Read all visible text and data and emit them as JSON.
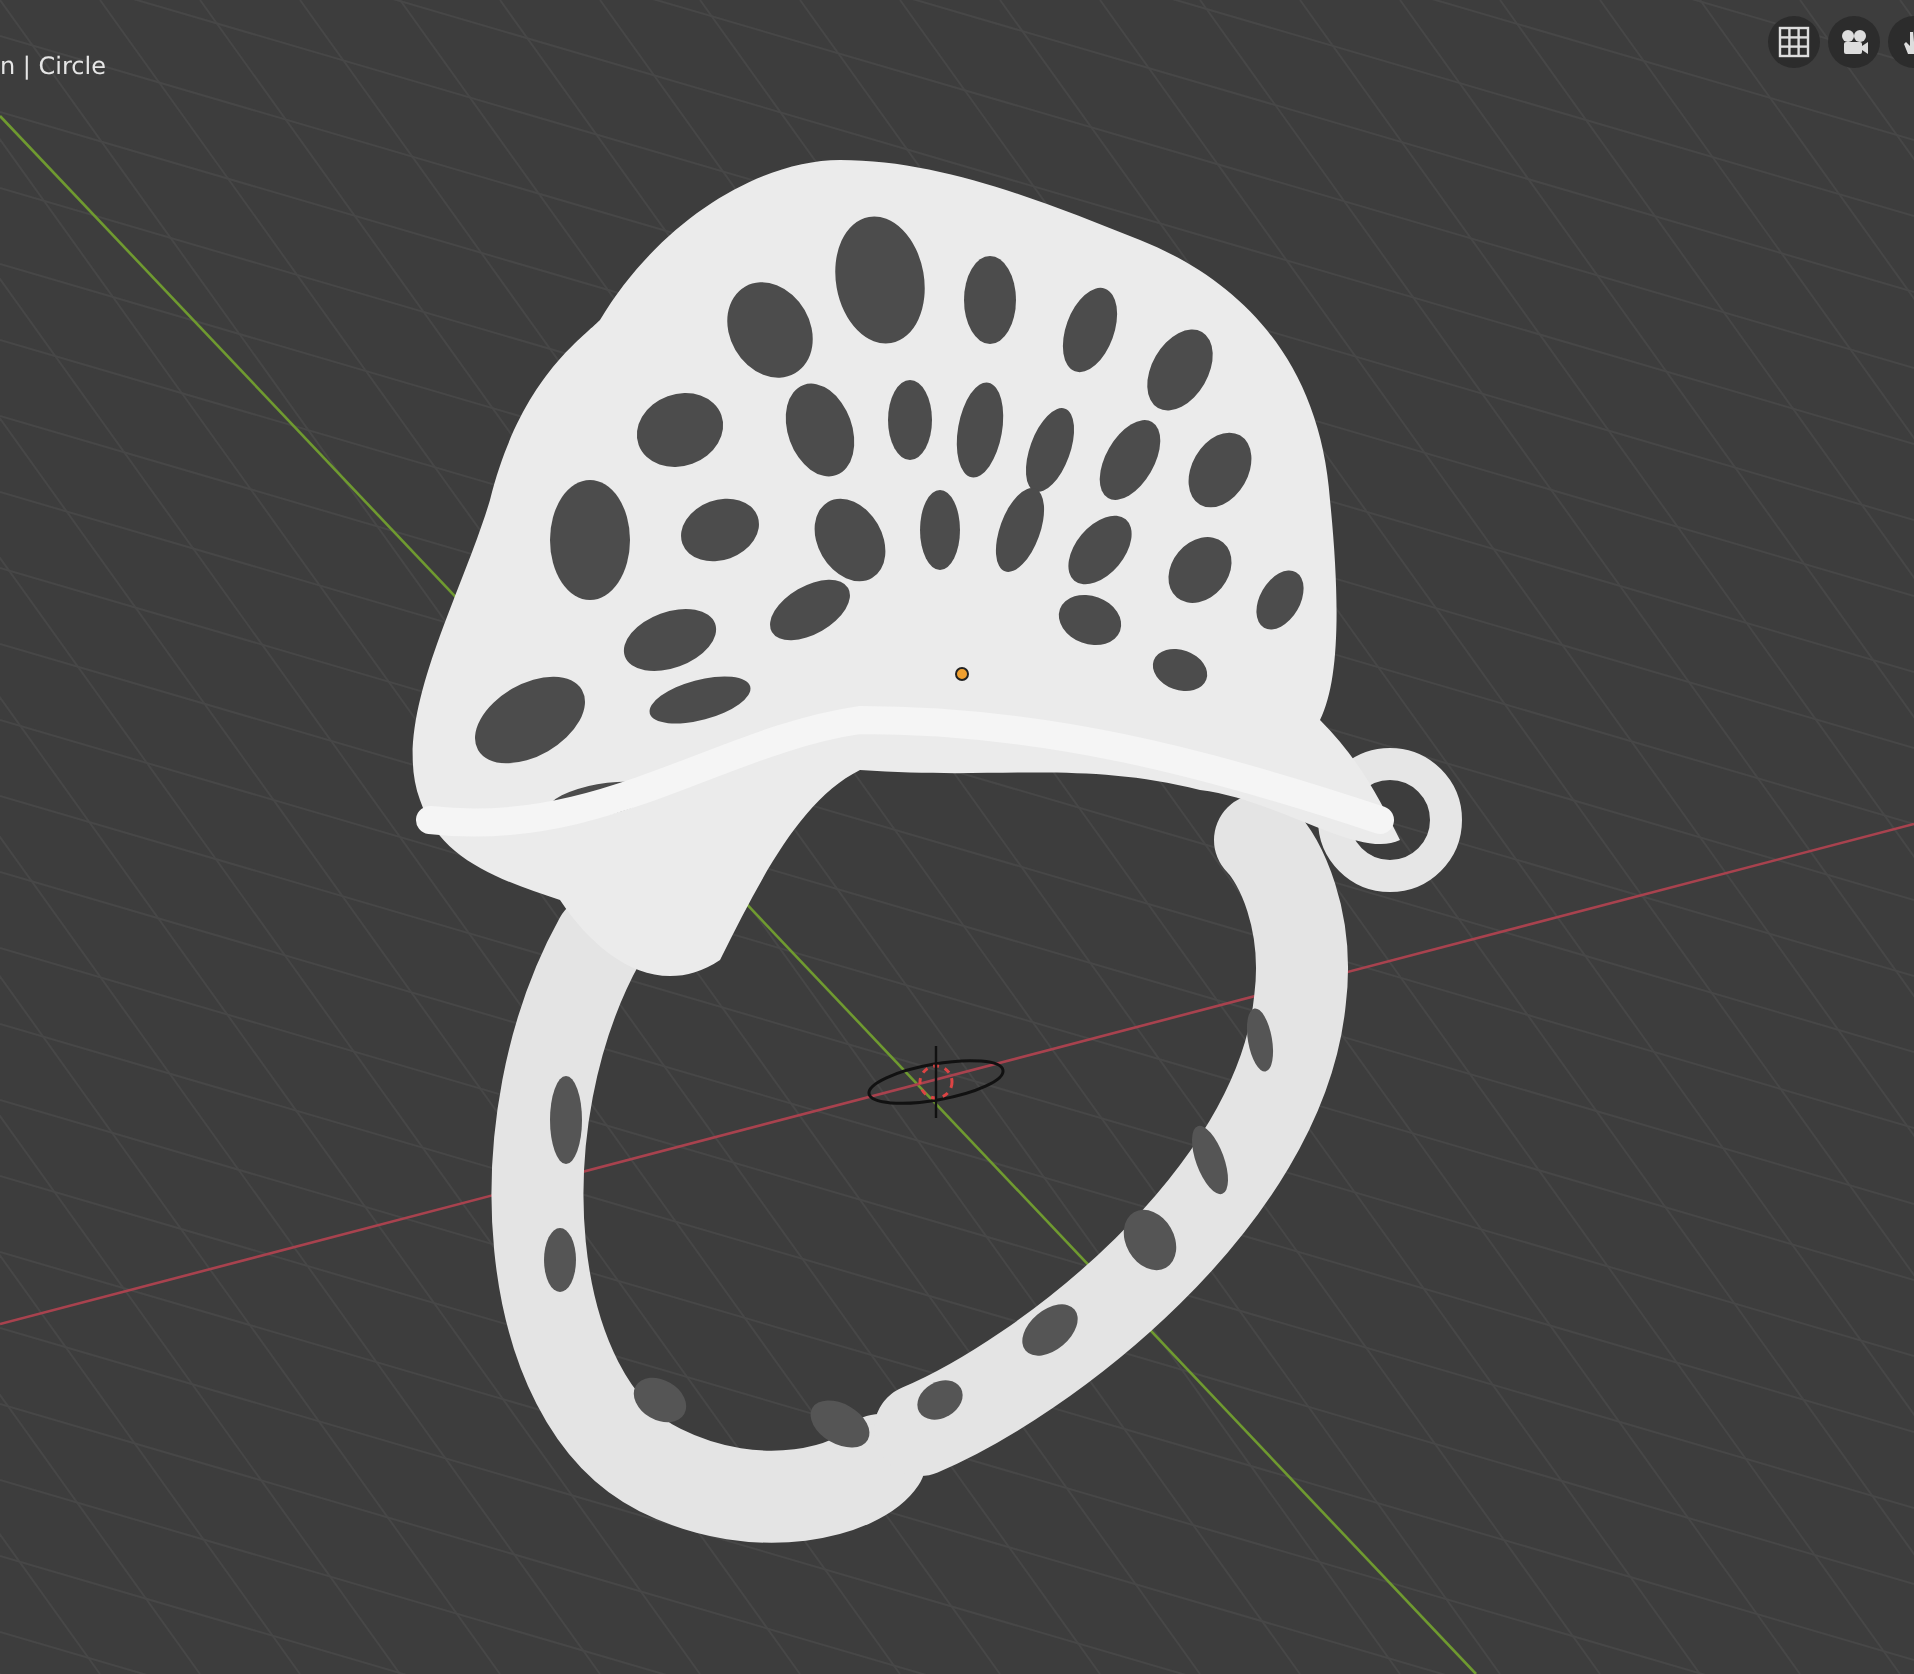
{
  "viewport": {
    "object_label": "n | Circle"
  }
}
